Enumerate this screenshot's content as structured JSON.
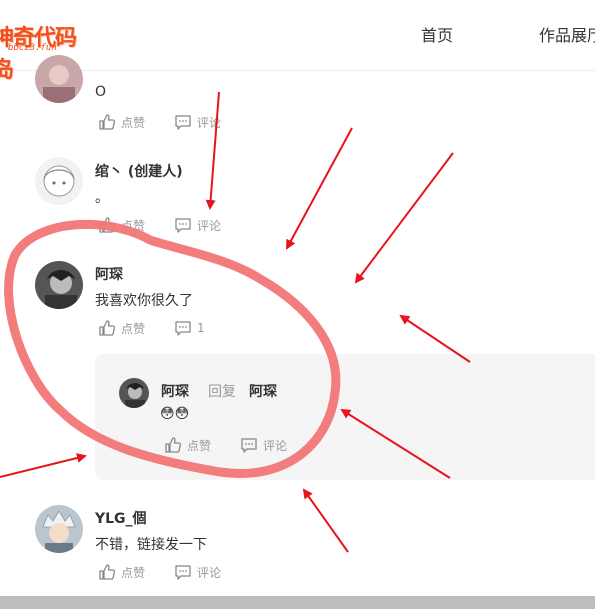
{
  "header": {
    "logo_text": "神奇代码岛",
    "logo_sub": "bbcz3.fun",
    "nav": [
      {
        "label": "首页"
      },
      {
        "label": "作品展厅"
      }
    ]
  },
  "comments": [
    {
      "name": "",
      "text": "O",
      "like_label": "点赞",
      "comment_label": "评论"
    },
    {
      "name": "绾丶 (创建人)",
      "text": "。",
      "like_label": "点赞",
      "comment_label": "评论"
    },
    {
      "name": "阿琛",
      "text": "我喜欢你很久了",
      "like_label": "点赞",
      "comment_count": "1",
      "reply": {
        "name": "阿琛",
        "reply_word": "回复",
        "target": "阿琛",
        "text": "😳😳",
        "like_label": "点赞",
        "comment_label": "评论"
      }
    },
    {
      "name": "YLG_個",
      "text": "不错，链接发一下",
      "like_label": "点赞",
      "comment_label": "评论"
    }
  ],
  "colors": {
    "annotation_red": "#e8141b",
    "highlight_stroke": "#f27576",
    "logo_orange": "#f0501e"
  },
  "icons": [
    "thumb-up-icon",
    "comment-icon"
  ]
}
